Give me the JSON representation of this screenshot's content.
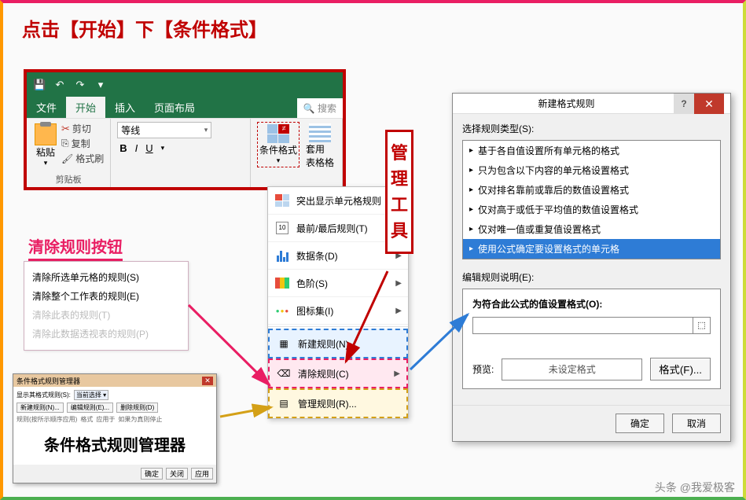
{
  "title": "点击【开始】下【条件格式】",
  "ribbon": {
    "qat": {
      "save": "💾",
      "undo": "↶",
      "redo": "↷",
      "more": "▾"
    },
    "tabs": {
      "file": "文件",
      "home": "开始",
      "insert": "插入",
      "layout": "页面布局",
      "search": "🔍 搜索"
    },
    "clipboard": {
      "paste": "粘贴",
      "cut": "剪切",
      "copy": "复制",
      "painter": "格式刷",
      "group": "剪贴板"
    },
    "font": {
      "name": "等线",
      "bold": "B",
      "italic": "I",
      "underline": "U"
    },
    "cond": {
      "label": "条件格式",
      "table": "套用\n表格格"
    }
  },
  "cf_menu": {
    "highlight": "突出显示单元格规则",
    "topbottom": "最前/最后规则(T)",
    "databars": "数据条(D)",
    "colorscales": "色阶(S)",
    "iconsets": "图标集(I)",
    "newrule": "新建规则(N)...",
    "clearrule": "清除规则(C)",
    "managerule": "管理规则(R)...",
    "ten": "10"
  },
  "mgmt_label": "管理工具",
  "clear": {
    "title": "清除规则按钮",
    "selected": "清除所选单元格的规则(S)",
    "sheet": "清除整个工作表的规则(E)",
    "table": "清除此表的规则(T)",
    "pivot": "清除此数据透视表的规则(P)"
  },
  "mgr": {
    "title": "条件格式规则管理器",
    "show_label": "显示其格式规则(S):",
    "show_value": "当前选择",
    "new": "新建规则(N)...",
    "edit": "编辑规则(E)...",
    "delete": "删除规则(D)",
    "col1": "规则(按所示顺序应用)",
    "col2": "格式",
    "col3": "应用于",
    "col4": "如果为真则停止",
    "big": "条件格式规则管理器",
    "ok": "确定",
    "close": "关闭",
    "apply": "应用"
  },
  "dlg": {
    "title": "新建格式规则",
    "select_label": "选择规则类型(S):",
    "rules": {
      "r1": "基于各自值设置所有单元格的格式",
      "r2": "只为包含以下内容的单元格设置格式",
      "r3": "仅对排名靠前或靠后的数值设置格式",
      "r4": "仅对高于或低于平均值的数值设置格式",
      "r5": "仅对唯一值或重复值设置格式",
      "r6": "使用公式确定要设置格式的单元格"
    },
    "edit_label": "编辑规则说明(E):",
    "formula_label": "为符合此公式的值设置格式(O):",
    "preview_label": "预览:",
    "preview_text": "未设定格式",
    "format_btn": "格式(F)...",
    "ok": "确定",
    "cancel": "取消"
  },
  "watermark": "头条 @我爱极客"
}
